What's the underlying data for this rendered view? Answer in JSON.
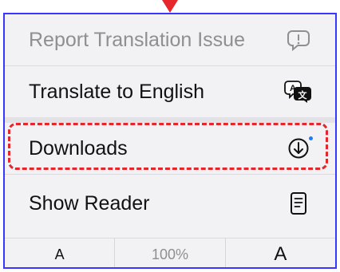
{
  "menu": {
    "items": [
      {
        "label": "Report Translation Issue",
        "icon": "exclamation-bubble-icon",
        "disabled": true
      },
      {
        "label": "Translate to English",
        "icon": "translate-icon",
        "disabled": false
      },
      {
        "label": "Downloads",
        "icon": "download-circle-icon",
        "disabled": false,
        "highlighted": true,
        "badge": true
      },
      {
        "label": "Show Reader",
        "icon": "reader-doc-icon",
        "disabled": false
      }
    ]
  },
  "font_size": {
    "decrease_label": "A",
    "zoom_level": "100%",
    "increase_label": "A"
  },
  "colors": {
    "highlight": "#e5262c",
    "frame_border": "#3a35ff",
    "badge": "#1a7cff",
    "disabled_text": "#8e8e93"
  }
}
